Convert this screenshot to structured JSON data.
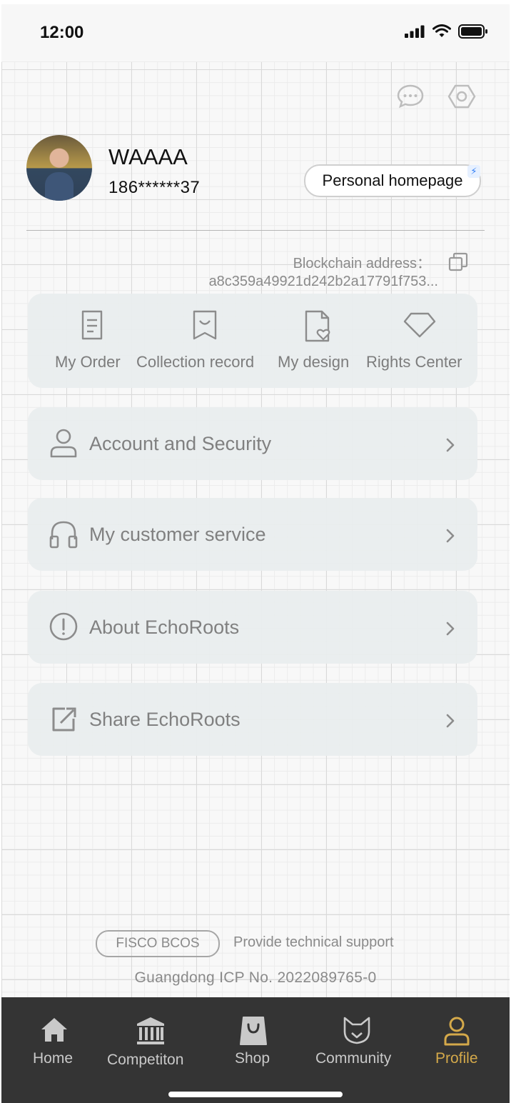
{
  "status_bar": {
    "time": "12:00"
  },
  "profile": {
    "username": "WAAAA",
    "phone": "186******37",
    "homepage_button": "Personal homepage",
    "blockchain_label": "Blockchain address：",
    "blockchain_address": "a8c359a49921d242b2a17791f753..."
  },
  "quick_actions": [
    {
      "label": "My Order",
      "icon": "order-document-icon"
    },
    {
      "label": "Collection record",
      "icon": "bookmark-icon"
    },
    {
      "label": "My design",
      "icon": "design-file-heart-icon"
    },
    {
      "label": "Rights Center",
      "icon": "diamond-icon"
    }
  ],
  "menu": [
    {
      "label": "Account and Security",
      "icon": "user-icon"
    },
    {
      "label": "My customer service",
      "icon": "headset-icon"
    },
    {
      "label": "About EchoRoots",
      "icon": "info-exclamation-icon"
    },
    {
      "label": "Share EchoRoots",
      "icon": "share-external-icon"
    }
  ],
  "footer": {
    "badge": "FISCO BCOS",
    "support_text": "Provide technical support",
    "icp": "Guangdong ICP No. 2022089765-0"
  },
  "tabbar": {
    "active_color": "#d4a94a",
    "inactive_color": "#c9c9c9",
    "tabs": [
      {
        "label": "Home",
        "icon": "home-icon"
      },
      {
        "label": "Competiton",
        "icon": "museum-icon"
      },
      {
        "label": "Shop",
        "icon": "shopping-bag-icon"
      },
      {
        "label": "Community",
        "icon": "cat-icon"
      },
      {
        "label": "Profile",
        "icon": "profile-icon",
        "active": true
      }
    ]
  }
}
